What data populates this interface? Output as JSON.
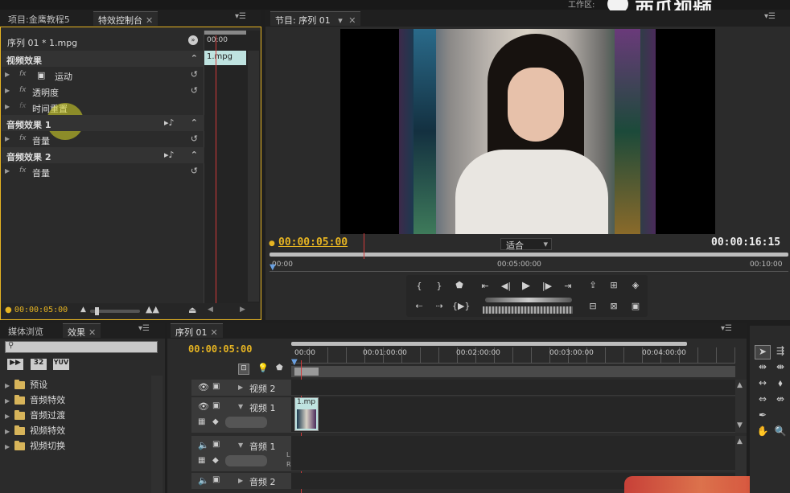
{
  "top_bar": {
    "workspace_label": "工作区:",
    "watermark_text": "西瓜视频",
    "right_fragment": "NC"
  },
  "left_panel": {
    "tabs": [
      {
        "label": "项目:金鹰教程5",
        "active": false
      },
      {
        "label": "特效控制台",
        "active": true
      }
    ],
    "sequence_label": "序列 01 * 1.mpg",
    "timeline_time": "00:00",
    "clip_name": "1.mpg",
    "video_effects_header": "视频效果",
    "items": [
      {
        "label": "运动"
      },
      {
        "label": "透明度"
      },
      {
        "label": "时间重置"
      }
    ],
    "audio1_header": "音频效果 1",
    "audio1_item": "音量",
    "audio2_header": "音频效果 2",
    "audio2_item": "音量",
    "footer_time": "00:00:05:00"
  },
  "program_monitor": {
    "tab_label": "节目: 序列 01",
    "current_time": "00:00:05:00",
    "duration": "00:00:16:15",
    "fit_select": "适合",
    "ruler_labels": [
      "00:00",
      "00:05:00:00",
      "00:10:00"
    ],
    "image_alt": "woman-portrait-video-frame"
  },
  "bottom_left": {
    "tabs": [
      {
        "label": "媒体浏览",
        "active": false
      },
      {
        "label": "效果",
        "active": true
      }
    ],
    "search_placeholder": "",
    "badges": [
      "32",
      "YUV"
    ],
    "folders": [
      "预设",
      "音频特效",
      "音频过渡",
      "视频特效",
      "视频切换"
    ]
  },
  "timeline": {
    "tab_label": "序列 01",
    "current_time": "00:00:05:00",
    "ruler_labels": [
      "00:00",
      "00:01:00:00",
      "00:02:00:00",
      "00:03:00:00",
      "00:04:00:00"
    ],
    "tracks": [
      {
        "name": "视频 2"
      },
      {
        "name": "视频 1"
      },
      {
        "name": "音频 1"
      },
      {
        "name": "音频 2"
      }
    ],
    "clip_label": "1.mp",
    "lr_labels": [
      "L",
      "R"
    ]
  },
  "colors": {
    "accent_yellow": "#e6b422",
    "playhead_red": "#d23a3a",
    "clip_teal": "#bfe3e0",
    "panel_bg": "#2a2a2a"
  }
}
